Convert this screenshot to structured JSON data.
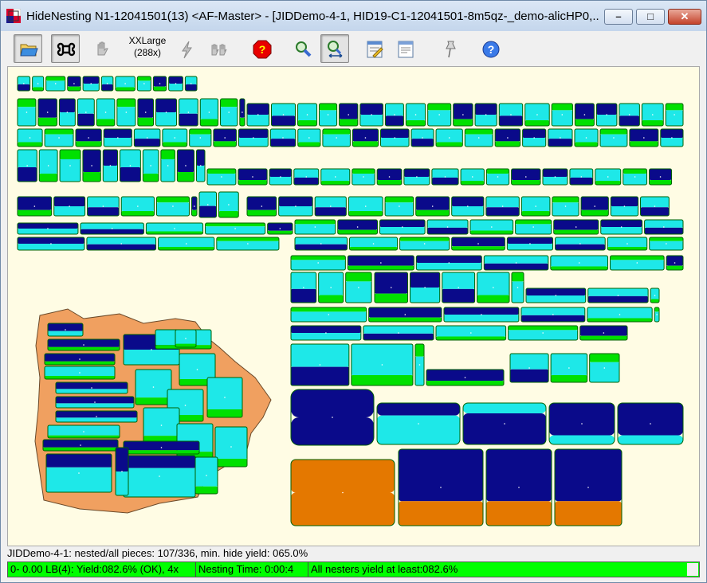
{
  "window": {
    "title": "HideNesting N1-12041501(13) <AF-Master> - [JIDDemo-4-1, HID19-C1-12041501-8m5qz-_demo-alicHP0,...",
    "min_glyph": "–",
    "max_glyph": "□",
    "close_glyph": "✕"
  },
  "toolbar": {
    "size_label_line1": "XXLarge",
    "size_label_line2": "(288x)",
    "buttons": [
      {
        "icon": "folder-open-icon"
      },
      {
        "icon": "command-key-icon",
        "pressed": true
      },
      {
        "icon": "hand-disabled-icon"
      },
      {
        "icon": "lightning-icon"
      },
      {
        "icon": "hands-disabled-icon"
      },
      {
        "icon": "stop-question-icon"
      },
      {
        "icon": "zoom-icon"
      },
      {
        "icon": "zoom-fit-icon",
        "pressed": true
      },
      {
        "icon": "report-icon"
      },
      {
        "icon": "form-icon"
      },
      {
        "icon": "pushpin-icon"
      },
      {
        "icon": "help-icon"
      }
    ]
  },
  "colors": {
    "canvas_bg": "#fffce4",
    "piece_navy": "#0a0a8a",
    "piece_cyan": "#1ee8e8",
    "piece_green": "#00e000",
    "piece_orange": "#e47800",
    "hide_tan": "#f0a060",
    "status_green": "#00ff00"
  },
  "status": {
    "line1": "JIDDemo-4-1: nested/all pieces: 107/336, min. hide yield: 065.0%",
    "yield": "0- 0.00 LB(4): Yield:082.6% (OK), 4x",
    "nesting_time": "Nesting Time: 0:00:4",
    "all_nesters": "All nesters yield at least:082.6%"
  }
}
